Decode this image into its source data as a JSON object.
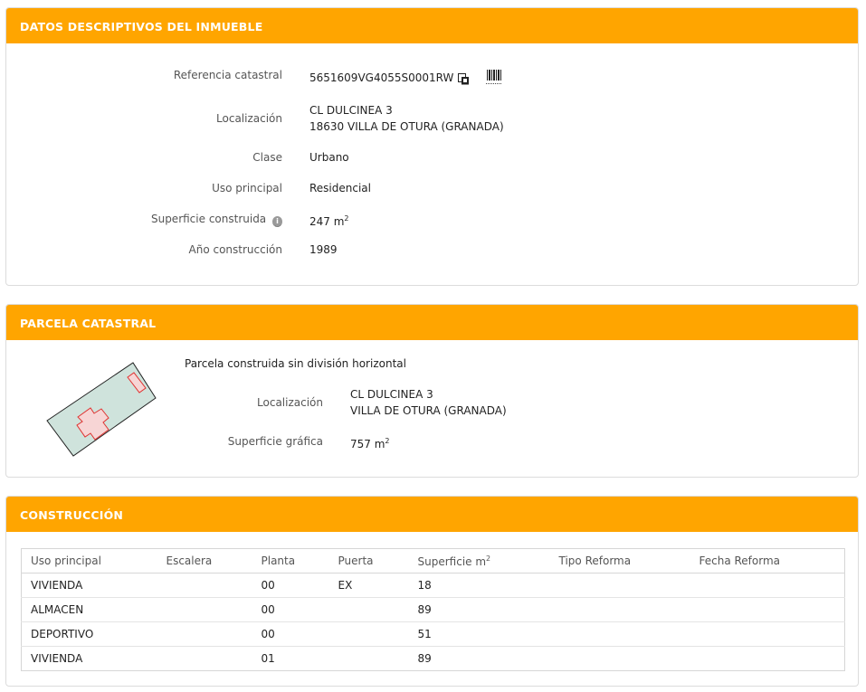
{
  "datos": {
    "header": "DATOS DESCRIPTIVOS DEL INMUEBLE",
    "ref_label": "Referencia catastral",
    "ref_value": "5651609VG4055S0001RW",
    "loc_label": "Localización",
    "loc_line1": "CL DULCINEA 3",
    "loc_line2": "18630 VILLA DE OTURA (GRANADA)",
    "clase_label": "Clase",
    "clase_value": "Urbano",
    "uso_label": "Uso principal",
    "uso_value": "Residencial",
    "sup_label": "Superficie construida",
    "sup_value": "247 m",
    "sup_unit_sup": "2",
    "anio_label": "Año construcción",
    "anio_value": "1989"
  },
  "parcela": {
    "header": "PARCELA CATASTRAL",
    "desc": "Parcela construida sin división horizontal",
    "loc_label": "Localización",
    "loc_line1": "CL DULCINEA 3",
    "loc_line2": "VILLA DE OTURA (GRANADA)",
    "sup_label": "Superficie gráfica",
    "sup_value": "757 m",
    "sup_unit_sup": "2"
  },
  "construccion": {
    "header": "CONSTRUCCIÓN",
    "columns": [
      "Uso principal",
      "Escalera",
      "Planta",
      "Puerta",
      "Superficie m",
      "Tipo Reforma",
      "Fecha Reforma"
    ],
    "superficie_sup": "2",
    "rows": [
      [
        "VIVIENDA",
        "",
        "00",
        "EX",
        "18",
        "",
        ""
      ],
      [
        "ALMACEN",
        "",
        "00",
        "",
        "89",
        "",
        ""
      ],
      [
        "DEPORTIVO",
        "",
        "00",
        "",
        "51",
        "",
        ""
      ],
      [
        "VIVIENDA",
        "",
        "01",
        "",
        "89",
        "",
        ""
      ]
    ]
  },
  "colors": {
    "header_bg": "#ffa500",
    "parcel_fill": "#cfe3dc",
    "building_outline": "#e0312f"
  }
}
